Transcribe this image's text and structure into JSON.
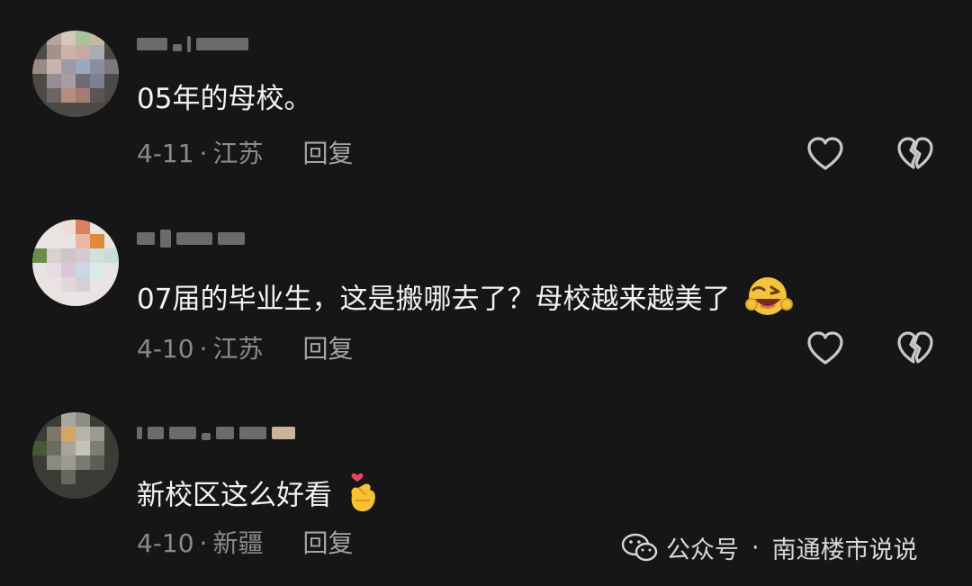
{
  "comments": [
    {
      "text": "05年的母校。",
      "date": "4-11",
      "separator": "·",
      "location": "江苏",
      "reply_label": "回复",
      "emoji": ""
    },
    {
      "text": "07届的毕业生，这是搬哪去了？母校越来越美了",
      "date": "4-10",
      "separator": "·",
      "location": "江苏",
      "reply_label": "回复",
      "emoji": "laughing-wink-emoji"
    },
    {
      "text": "新校区这么好看",
      "date": "4-10",
      "separator": "·",
      "location": "新疆",
      "reply_label": "回复",
      "emoji": "finger-heart-emoji"
    }
  ],
  "watermark": {
    "dot": "·",
    "label_left": "公众号",
    "label_right": "南通楼市说说"
  },
  "colors": {
    "background": "#161616",
    "text": "#f2f2f2",
    "meta": "#8a8a8a",
    "icon": "#c8c8c8"
  }
}
